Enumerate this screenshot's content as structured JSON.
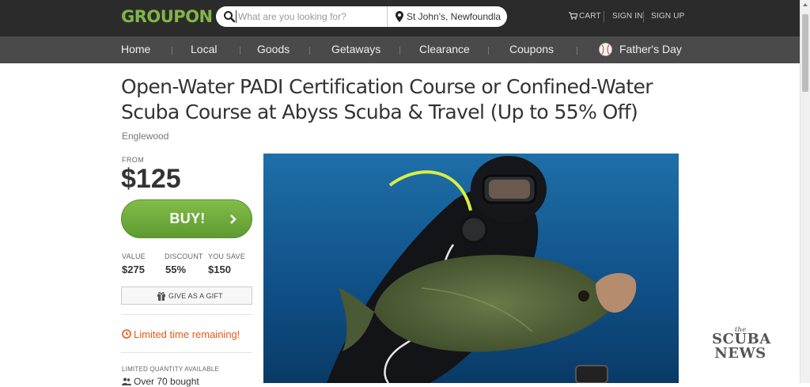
{
  "header": {
    "logo": "GROUPON",
    "search": {
      "placeholder": "What are you looking for?",
      "location": "St John's, Newfoundla"
    },
    "cart_label": "CART",
    "signin_label": "SIGN IN",
    "signup_label": "SIGN UP"
  },
  "nav": {
    "items": [
      "Home",
      "Local",
      "Goods",
      "Getaways",
      "Clearance",
      "Coupons",
      "Father's Day"
    ]
  },
  "deal": {
    "title_line1": "Open-Water PADI Certification Course or Confined-Water",
    "title_line2": "Scuba Course at Abyss Scuba & Travel (Up to 55% Off)",
    "location": "Englewood",
    "from_label": "FROM",
    "price": "$125",
    "buy_label": "BUY!",
    "stats": {
      "value_label": "VALUE",
      "value": "$275",
      "discount_label": "DISCOUNT",
      "discount": "55%",
      "save_label": "YOU SAVE",
      "save": "$150"
    },
    "gift_label": "GIVE AS A GIFT",
    "limited_time": "Limited time remaining!",
    "quantity_label": "LIMITED QUANTITY AVAILABLE",
    "bought": "Over 70 bought"
  },
  "watermark": {
    "small": "the",
    "line1": "SCUBA",
    "line2": "NEWS"
  },
  "colors": {
    "brand_green": "#82b548",
    "buy_green": "#6aa83a",
    "alert_orange": "#e55a1a",
    "topbar": "#2b2b2b",
    "navbar": "#4a4a4a"
  },
  "icons": [
    "search-icon",
    "location-pin-icon",
    "cart-icon",
    "baseball-icon",
    "chevron-right-icon",
    "gift-icon",
    "clock-icon",
    "people-icon"
  ]
}
